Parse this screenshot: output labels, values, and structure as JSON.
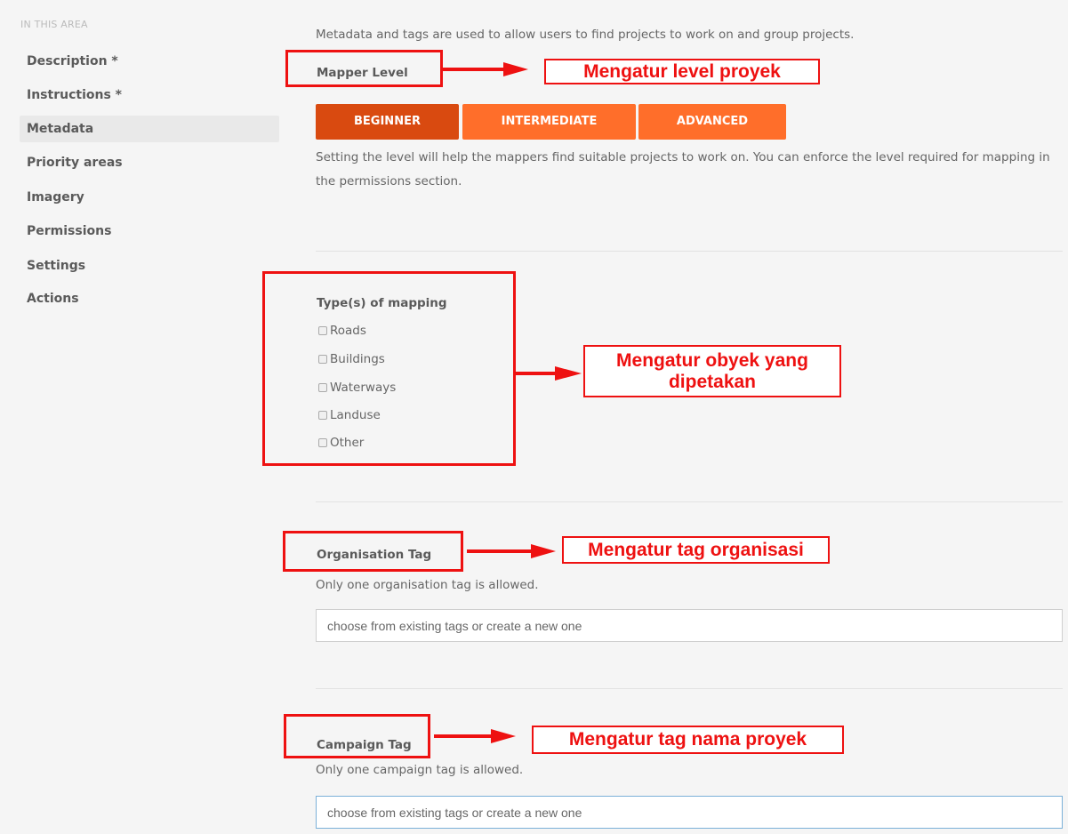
{
  "sidebar": {
    "heading": "IN THIS AREA",
    "items": [
      {
        "label": "Description *"
      },
      {
        "label": "Instructions *"
      },
      {
        "label": "Metadata",
        "active": true
      },
      {
        "label": "Priority areas"
      },
      {
        "label": "Imagery"
      },
      {
        "label": "Permissions"
      },
      {
        "label": "Settings"
      },
      {
        "label": "Actions"
      }
    ]
  },
  "main": {
    "intro": "Metadata and tags are used to allow users to find projects to work on and group projects.",
    "mapper_level": {
      "label": "Mapper Level",
      "buttons": [
        {
          "label": "BEGINNER",
          "active": true
        },
        {
          "label": "INTERMEDIATE"
        },
        {
          "label": "ADVANCED"
        }
      ],
      "help": "Setting the level will help the mappers find suitable projects to work on. You can enforce the level required for mapping in the permissions section."
    },
    "mapping_types": {
      "label": "Type(s) of mapping",
      "options": [
        "Roads",
        "Buildings",
        "Waterways",
        "Landuse",
        "Other"
      ]
    },
    "organisation_tag": {
      "label": "Organisation Tag",
      "help": "Only one organisation tag is allowed.",
      "placeholder": "choose from existing tags or create a new one"
    },
    "campaign_tag": {
      "label": "Campaign Tag",
      "help": "Only one campaign tag is allowed.",
      "placeholder": "choose from existing tags or create a new one"
    }
  },
  "annotations": {
    "level": "Mengatur level proyek",
    "mapping_line1": "Mengatur obyek yang",
    "mapping_line2": "dipetakan",
    "organisation": "Mengatur tag organisasi",
    "campaign": "Mengatur tag nama proyek",
    "color": "#ee1111"
  },
  "colors": {
    "accent": "#ff6e2a",
    "accent_active": "#d94a10",
    "background": "#f5f5f5"
  }
}
